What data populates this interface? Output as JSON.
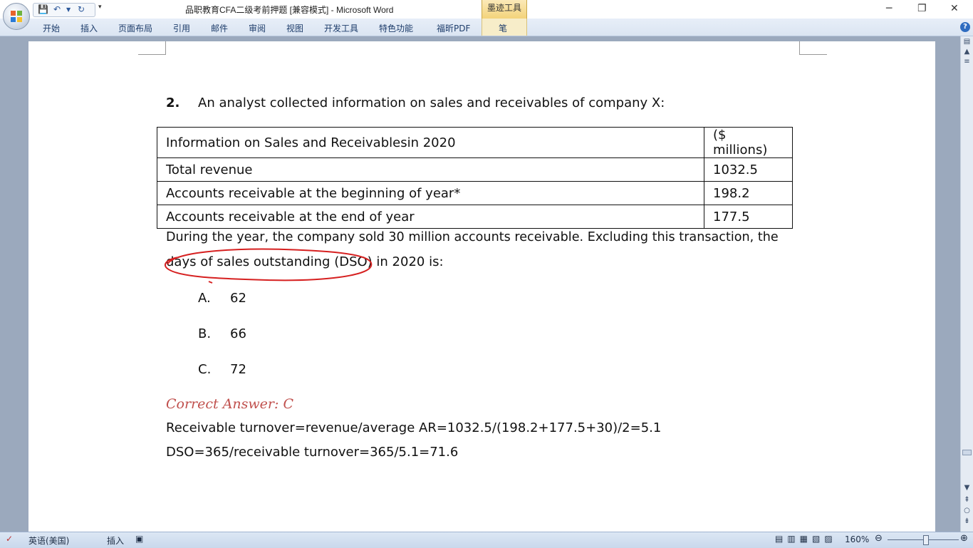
{
  "window": {
    "title": "品职教育CFA二级考前押题 [兼容模式] - Microsoft Word",
    "contextual_tab_group": "墨迹工具",
    "controls": [
      "minimize",
      "restore",
      "close"
    ]
  },
  "ribbon": {
    "tabs": [
      "开始",
      "插入",
      "页面布局",
      "引用",
      "邮件",
      "审阅",
      "视图",
      "开发工具",
      "特色功能",
      "福昕PDF",
      "笔"
    ]
  },
  "document": {
    "question_number": "2.",
    "question_text": "An analyst collected information on sales and receivables of company X:",
    "table": {
      "header": [
        "Information on Sales and Receivablesin 2020",
        "($ millions)"
      ],
      "rows": [
        [
          "Total revenue",
          "1032.5"
        ],
        [
          "Accounts receivable at the beginning of year*",
          "198.2"
        ],
        [
          "Accounts receivable at the end of year",
          "177.5"
        ]
      ]
    },
    "paragraph_line1": "During the year, the company sold 30 million accounts receivable. Excluding this transaction, the",
    "paragraph_line2": "days of sales outstanding (DSO) in 2020 is:",
    "options": [
      {
        "letter": "A.",
        "value": "62"
      },
      {
        "letter": "B.",
        "value": "66"
      },
      {
        "letter": "C.",
        "value": "72"
      }
    ],
    "correct_answer": "Correct Answer: C",
    "explanation_line1": "Receivable turnover=revenue/average AR=1032.5/(198.2+177.5+30)/2=5.1",
    "explanation_line2": "DSO=365/receivable turnover=365/5.1=71.6"
  },
  "statusbar": {
    "language": "英语(美国)",
    "mode": "插入",
    "zoom": "160%"
  },
  "colors": {
    "answer_red": "#c0504d",
    "ink_red": "#d62020",
    "ribbon_bg": "#dbe5f2",
    "contextual_tab": "#f3d37a"
  }
}
